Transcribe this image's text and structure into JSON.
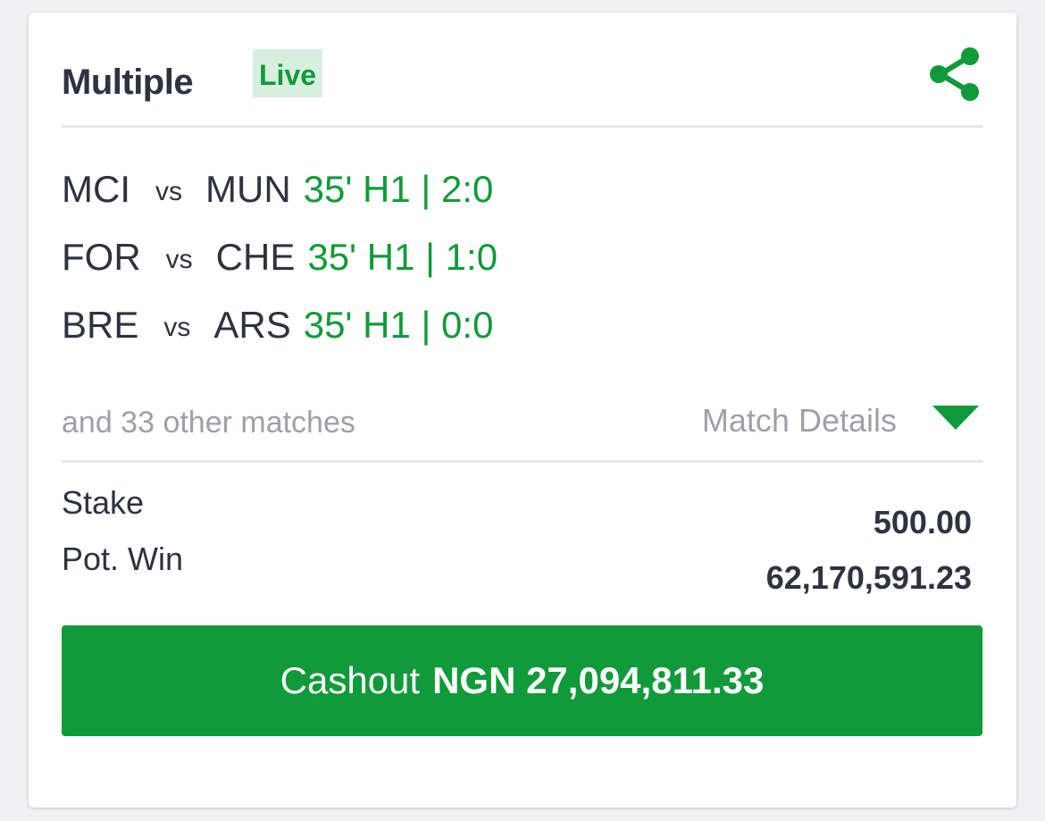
{
  "header": {
    "title": "Multiple",
    "badge": "Live"
  },
  "matches": [
    {
      "home": "MCI",
      "vs": "vs",
      "away": "MUN",
      "status": "35' H1 | 2:0"
    },
    {
      "home": "FOR",
      "vs": "vs",
      "away": "CHE",
      "status": "35' H1 | 1:0"
    },
    {
      "home": "BRE",
      "vs": "vs",
      "away": "ARS",
      "status": "35' H1 | 0:0"
    }
  ],
  "others": "and 33 other matches",
  "details_label": "Match Details",
  "summary": {
    "stake_label": "Stake",
    "stake_value": "500.00",
    "potwin_label": "Pot. Win",
    "potwin_value": "62,170,591.23"
  },
  "cashout": {
    "label": "Cashout",
    "amount": "NGN 27,094,811.33"
  },
  "colors": {
    "accent": "#109a39",
    "badge_bg": "#d8efdf",
    "text": "#2d3340",
    "muted": "#9da1a9"
  },
  "icons": {
    "share": "share-icon",
    "dropdown": "caret-down-icon"
  }
}
